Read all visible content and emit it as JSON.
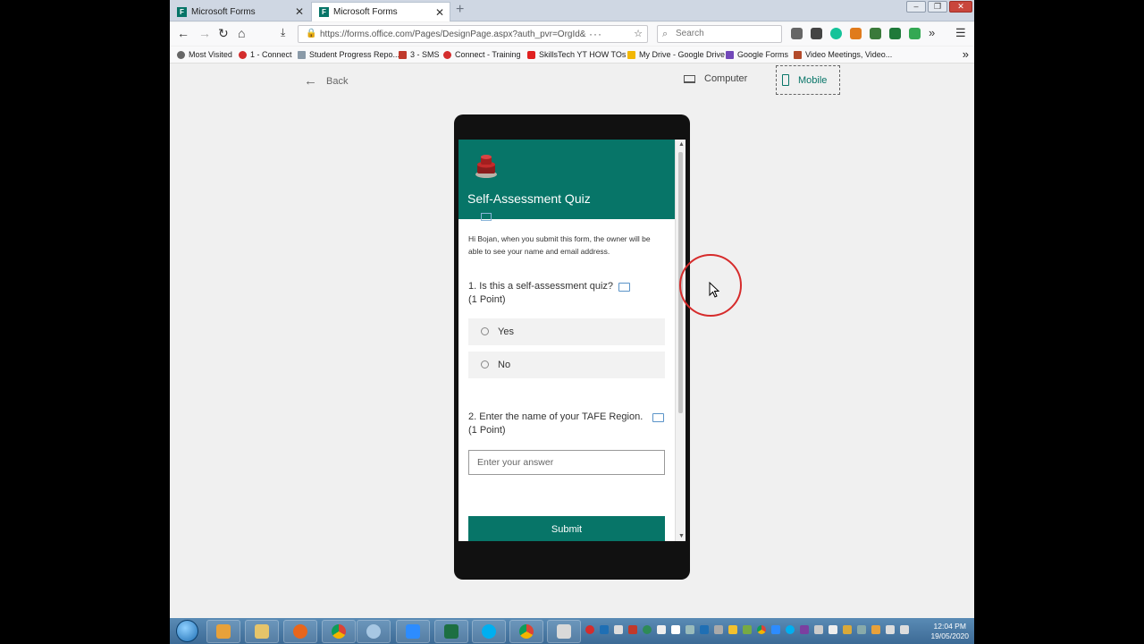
{
  "browser": {
    "tabs": [
      {
        "label": "Microsoft Forms"
      },
      {
        "label": "Microsoft Forms"
      }
    ],
    "url": "https://forms.office.com/Pages/DesignPage.aspx?auth_pvr=OrgId&",
    "search_placeholder": "Search",
    "bookmarks": [
      {
        "label": "Most Visited",
        "color": "#666666"
      },
      {
        "label": "1 - Connect",
        "color": "#d42d2d"
      },
      {
        "label": "Student Progress Repo...",
        "color": "#8a9aa8"
      },
      {
        "label": "3 - SMS",
        "color": "#c0392b"
      },
      {
        "label": "Connect - Training",
        "color": "#d42d2d"
      },
      {
        "label": "SkillsTech YT HOW TOs",
        "color": "#e02020"
      },
      {
        "label": "My Drive - Google Drive",
        "color": "#f2b705"
      },
      {
        "label": "Google Forms",
        "color": "#7248b9"
      },
      {
        "label": "Video Meetings, Video...",
        "color": "#b34a2a"
      }
    ]
  },
  "preview": {
    "back_label": "Back",
    "computer_label": "Computer",
    "mobile_label": "Mobile"
  },
  "form": {
    "title": "Self-Assessment Quiz",
    "note": "Hi Bojan, when you submit this form, the owner will be able to see your name and email address.",
    "questions": [
      {
        "text": "1. Is this a self-assessment quiz?",
        "points": "(1 Point)",
        "options": [
          "Yes",
          "No"
        ]
      },
      {
        "text": "2. Enter the name of your TAFE Region.",
        "points": "(1 Point)",
        "placeholder": "Enter your answer"
      }
    ],
    "submit_label": "Submit",
    "accent": "#077568"
  },
  "taskbar": {
    "time": "12:04 PM",
    "date": "19/05/2020"
  }
}
